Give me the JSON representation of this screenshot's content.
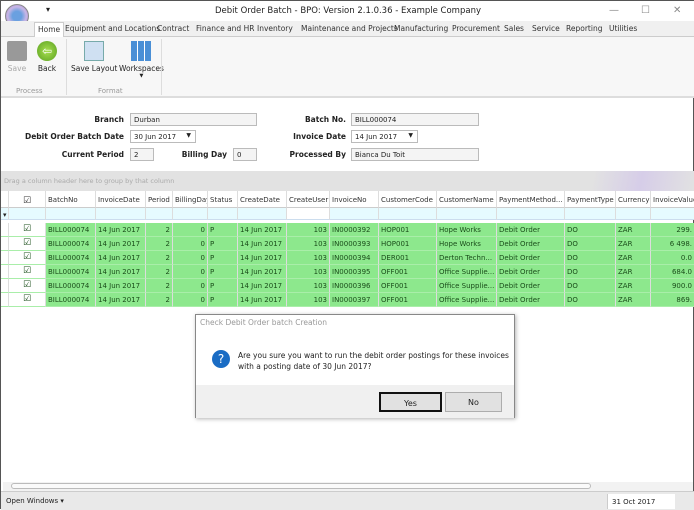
{
  "window": {
    "title": "Debit Order Batch - BPO: Version 2.1.0.36 - Example Company",
    "quick_access": "▾",
    "minimize": "—",
    "maximize": "☐",
    "close": "✕"
  },
  "tabs": [
    "Home",
    "Equipment and Locations",
    "Contract",
    "Finance and HR",
    "Inventory",
    "Maintenance and Projects",
    "Manufacturing",
    "Procurement",
    "Sales",
    "Service",
    "Reporting",
    "Utilities"
  ],
  "ribbon": {
    "save": "Save",
    "back": "Back",
    "save_layout": "Save Layout",
    "workspaces": "Workspaces",
    "group_process": "Process",
    "group_format": "Format"
  },
  "form": {
    "branch_label": "Branch",
    "branch": "Durban",
    "batch_date_label": "Debit Order Batch Date",
    "batch_date": "30 Jun 2017",
    "current_period_label": "Current Period",
    "current_period": "2",
    "billing_day_label": "Billing Day",
    "billing_day": "0",
    "batch_no_label": "Batch No.",
    "batch_no": "BILL000074",
    "invoice_date_label": "Invoice Date",
    "invoice_date": "14 Jun 2017",
    "processed_by_label": "Processed By",
    "processed_by": "Bianca Du Toit"
  },
  "grid": {
    "group_hint": "Drag a column header here to group by that column",
    "columns": [
      "BatchNo",
      "InvoiceDate",
      "Period",
      "BillingDay",
      "Status",
      "CreateDate",
      "CreateUser",
      "InvoiceNo",
      "CustomerCode",
      "CustomerName",
      "PaymentMethod...",
      "PaymentType",
      "Currency",
      "InvoiceValue"
    ],
    "rows": [
      [
        "BILL000074",
        "14 Jun 2017",
        "2",
        "0",
        "P",
        "14 Jun 2017",
        "103",
        "IN0000392",
        "HOP001",
        "Hope Works",
        "Debit Order",
        "DO",
        "ZAR",
        "299."
      ],
      [
        "BILL000074",
        "14 Jun 2017",
        "2",
        "0",
        "P",
        "14 Jun 2017",
        "103",
        "IN0000393",
        "HOP001",
        "Hope Works",
        "Debit Order",
        "DO",
        "ZAR",
        "6 498."
      ],
      [
        "BILL000074",
        "14 Jun 2017",
        "2",
        "0",
        "P",
        "14 Jun 2017",
        "103",
        "IN0000394",
        "DER001",
        "Derton Techn...",
        "Debit Order",
        "DO",
        "ZAR",
        "0.0"
      ],
      [
        "BILL000074",
        "14 Jun 2017",
        "2",
        "0",
        "P",
        "14 Jun 2017",
        "103",
        "IN0000395",
        "OFF001",
        "Office Supplie...",
        "Debit Order",
        "DO",
        "ZAR",
        "684.0"
      ],
      [
        "BILL000074",
        "14 Jun 2017",
        "2",
        "0",
        "P",
        "14 Jun 2017",
        "103",
        "IN0000396",
        "OFF001",
        "Office Supplie...",
        "Debit Order",
        "DO",
        "ZAR",
        "900.0"
      ],
      [
        "BILL000074",
        "14 Jun 2017",
        "2",
        "0",
        "P",
        "14 Jun 2017",
        "103",
        "IN0000397",
        "OFF001",
        "Office Supplie...",
        "Debit Order",
        "DO",
        "ZAR",
        "869."
      ]
    ]
  },
  "dialog": {
    "title": "Check Debit Order batch Creation",
    "message_line1": "Are you sure you want to run the debit order postings for these invoices",
    "message_line2": "with a posting date of 30 Jun 2017?",
    "yes": "Yes",
    "no": "No"
  },
  "statusbar": {
    "open_windows": "Open Windows ▾",
    "date": "31 Oct 2017"
  }
}
